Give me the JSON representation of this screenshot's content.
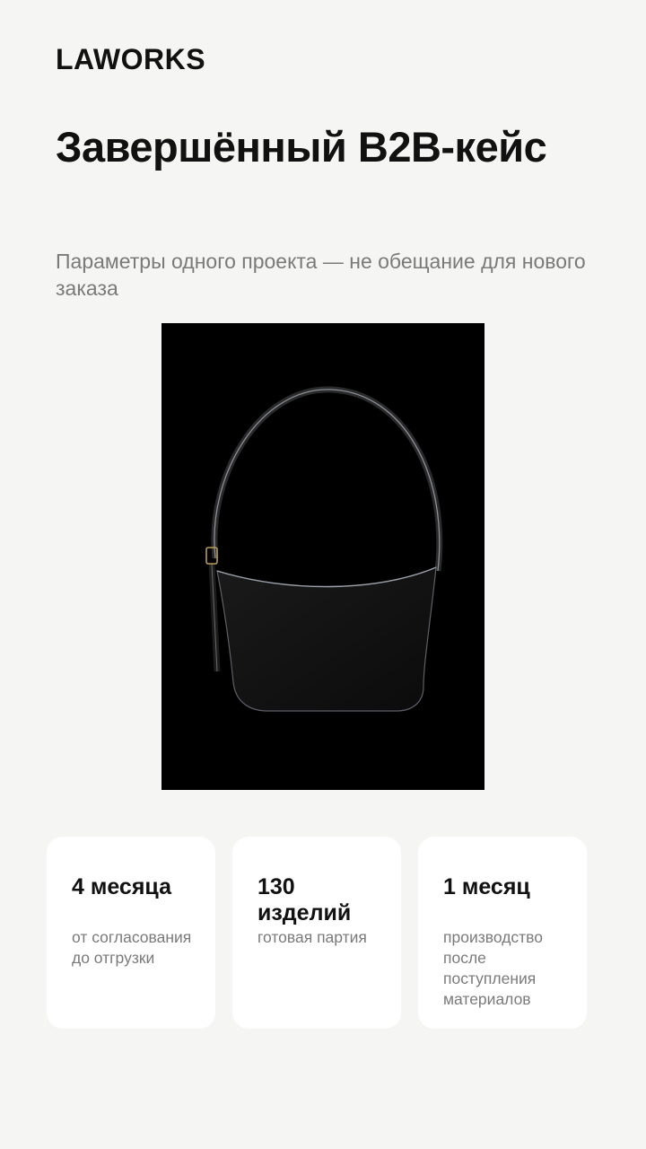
{
  "header": {
    "logo": "LAWORKS",
    "title": "Завершённый B2B-кейс",
    "subtitle": "Параметры одного проекта — не обещание для нового заказа"
  },
  "product_image": {
    "icon": "black-shoulder-bag-photo"
  },
  "stats": [
    {
      "value": "4 месяца",
      "description": "от согласования до отгрузки"
    },
    {
      "value": "130 изделий",
      "description": "готовая партия"
    },
    {
      "value": "1 месяц",
      "description": "производство после поступления материалов"
    }
  ],
  "colors": {
    "background": "#f5f5f3",
    "card": "#ffffff",
    "text": "#111111",
    "muted": "#7a7a7a",
    "photo_bg": "#000000"
  }
}
